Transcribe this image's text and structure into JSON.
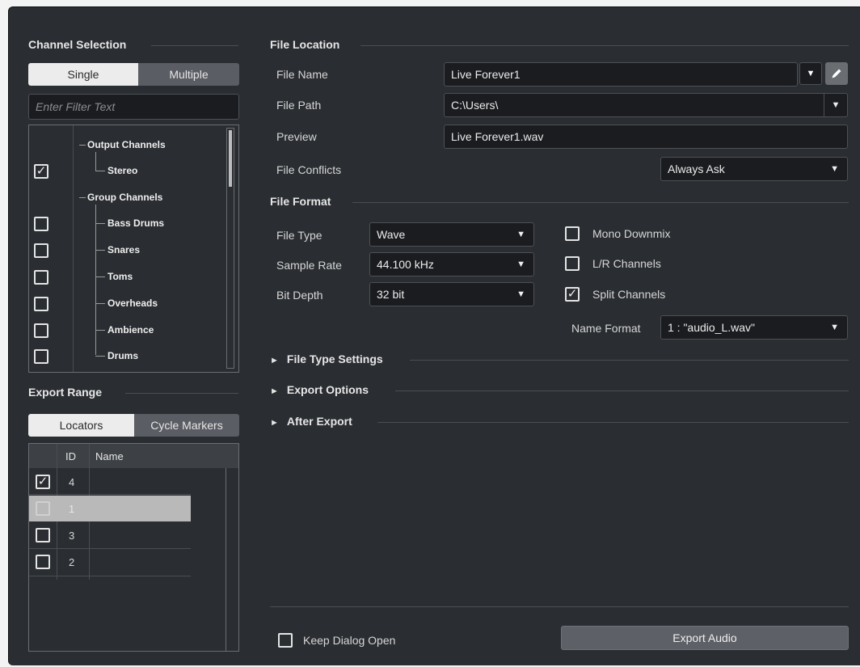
{
  "channel_selection": {
    "title": "Channel Selection",
    "tab_single": "Single",
    "tab_multiple": "Multiple",
    "filter_placeholder": "Enter Filter Text",
    "tree": {
      "output_channels": "Output Channels",
      "stereo": "Stereo",
      "group_channels": "Group Channels",
      "groups": [
        "Bass Drums",
        "Snares",
        "Toms",
        "Overheads",
        "Ambience",
        "Drums"
      ]
    }
  },
  "export_range": {
    "title": "Export Range",
    "tab_locators": "Locators",
    "tab_cycle_markers": "Cycle Markers",
    "col_id": "ID",
    "col_name": "Name",
    "rows": [
      {
        "id": "4",
        "checked": true
      },
      {
        "id": "1",
        "checked": false,
        "selected": true
      },
      {
        "id": "3",
        "checked": false
      },
      {
        "id": "2",
        "checked": false
      }
    ]
  },
  "file_location": {
    "title": "File Location",
    "file_name_label": "File Name",
    "file_name_value": "Live Forever1",
    "file_path_label": "File Path",
    "file_path_value": "C:\\Users\\",
    "preview_label": "Preview",
    "preview_value": "Live Forever1.wav",
    "file_conflicts_label": "File Conflicts",
    "file_conflicts_value": "Always Ask"
  },
  "file_format": {
    "title": "File Format",
    "file_type_label": "File Type",
    "file_type_value": "Wave",
    "sample_rate_label": "Sample Rate",
    "sample_rate_value": "44.100 kHz",
    "bit_depth_label": "Bit Depth",
    "bit_depth_value": "32 bit",
    "mono_downmix_label": "Mono Downmix",
    "lr_channels_label": "L/R Channels",
    "split_channels_label": "Split Channels",
    "name_format_label": "Name Format",
    "name_format_value": "1 : \"audio_L.wav\""
  },
  "sections": {
    "file_type_settings": "File Type Settings",
    "export_options": "Export Options",
    "after_export": "After Export"
  },
  "footer": {
    "keep_dialog_open": "Keep Dialog Open",
    "export_audio": "Export Audio"
  },
  "icons": {
    "dropdown": "▼",
    "disclosure": "►",
    "check": "✓",
    "pencil": "pencil-icon"
  }
}
